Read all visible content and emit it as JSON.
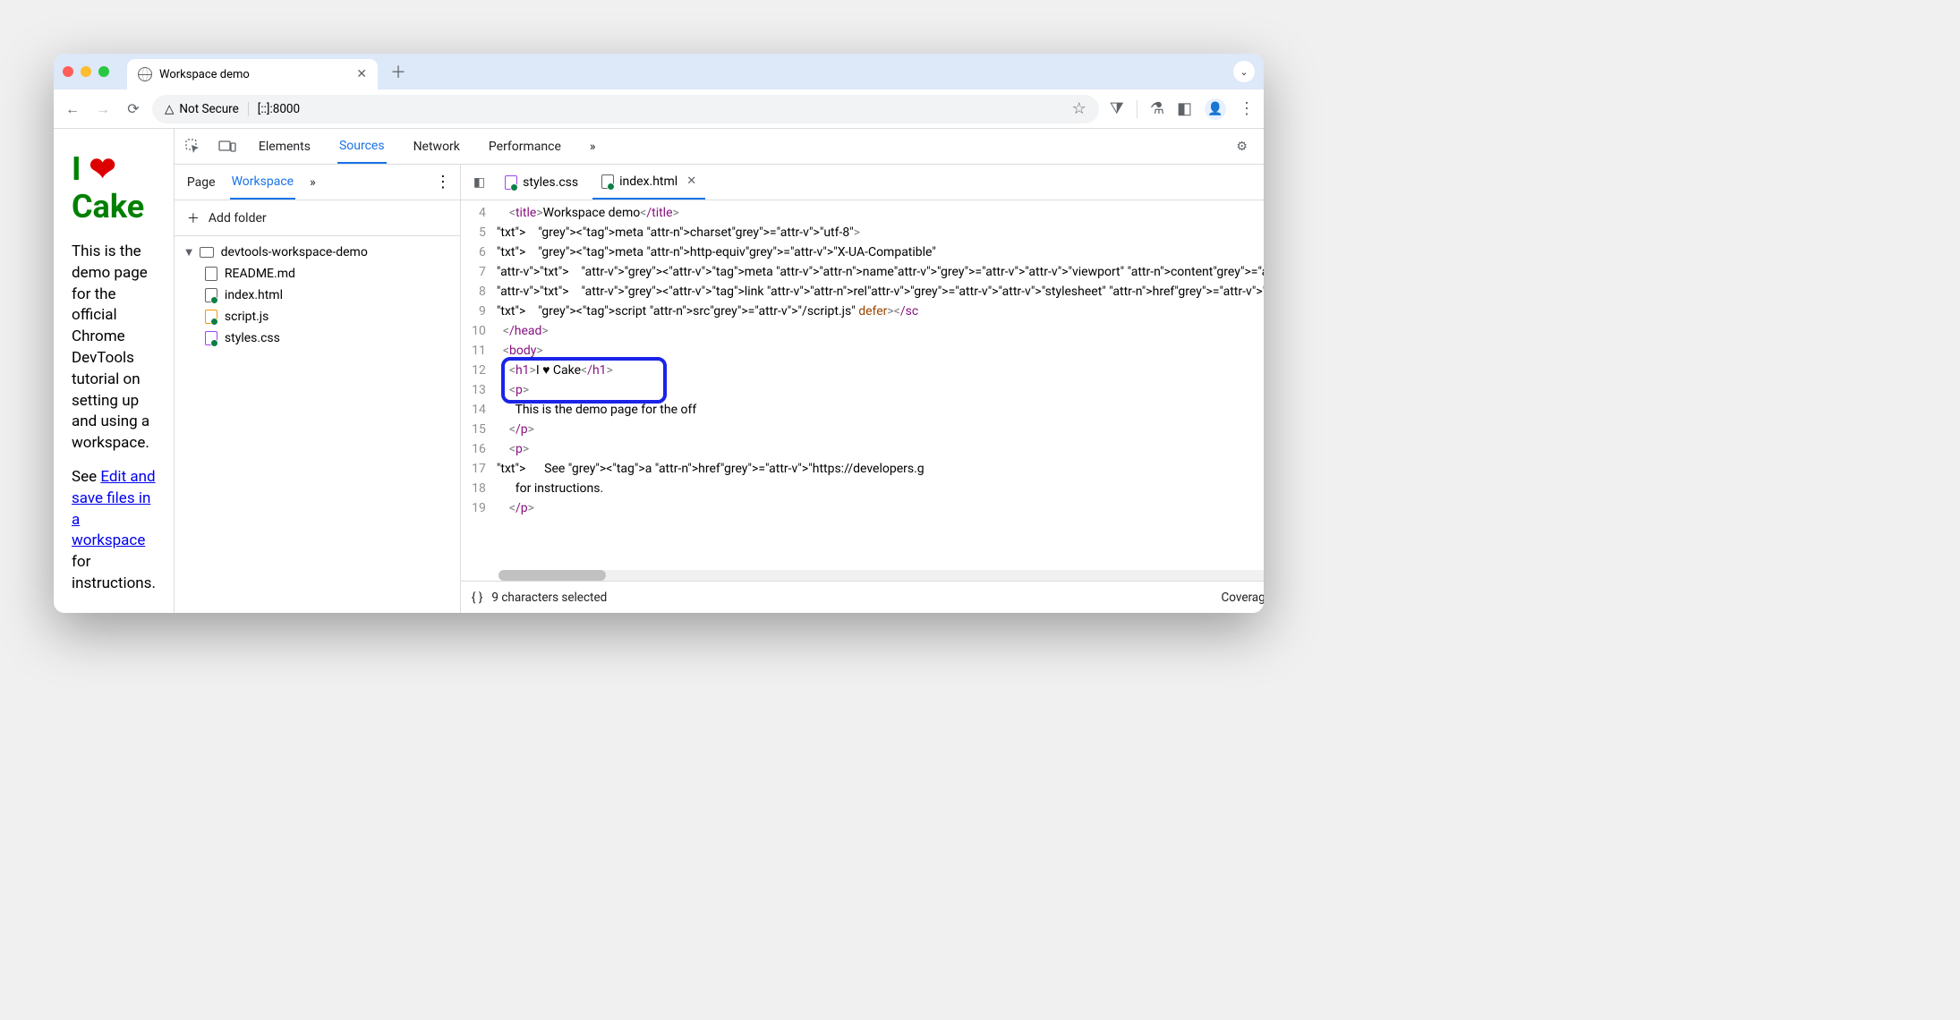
{
  "browser": {
    "tab_title": "Workspace demo",
    "addr_security": "Not Secure",
    "addr_url": "[::]:8000"
  },
  "demo_page": {
    "heading_pre": "I ",
    "heading_heart": "❤",
    "heading_post": " Cake",
    "para1": "This is the demo page for the official Chrome DevTools tutorial on setting up and using a workspace.",
    "para2_pre": "See ",
    "para2_link": "Edit and save files in a workspace",
    "para2_post": " for instructions."
  },
  "devtools": {
    "tabs": {
      "elements": "Elements",
      "sources": "Sources",
      "network": "Network",
      "performance": "Performance",
      "more": "»"
    },
    "sources_nav": {
      "page": "Page",
      "workspace": "Workspace",
      "more": "»",
      "add_folder": "Add folder",
      "folder": "devtools-workspace-demo",
      "files": {
        "readme": "README.md",
        "index": "index.html",
        "script": "script.js",
        "styles": "styles.css"
      }
    },
    "editor": {
      "open_tabs": {
        "styles": "styles.css",
        "index": "index.html"
      },
      "lines": [
        {
          "n": 4,
          "h": "    <title>Workspace demo</title>"
        },
        {
          "n": 5,
          "h": "    <meta charset=\"utf-8\">"
        },
        {
          "n": 6,
          "h": "    <meta http-equiv=\"X-UA-Compatible\" "
        },
        {
          "n": 7,
          "h": "    <meta name=\"viewport\" content=\"widt"
        },
        {
          "n": 8,
          "h": "    <link rel=\"stylesheet\" href=\"/style"
        },
        {
          "n": 9,
          "h": "    <script src=\"/script.js\" defer></sc"
        },
        {
          "n": 10,
          "h": "  </head>"
        },
        {
          "n": 11,
          "h": "  <body>"
        },
        {
          "n": 12,
          "h": "    <h1>I ♥ Cake</h1>"
        },
        {
          "n": 13,
          "h": "    <p>"
        },
        {
          "n": 14,
          "h": "      This is the demo page for the off"
        },
        {
          "n": 15,
          "h": "    </p>"
        },
        {
          "n": 16,
          "h": "    <p>"
        },
        {
          "n": 17,
          "h": "      See <a href=\"https://developers.g"
        },
        {
          "n": 18,
          "h": "      for instructions."
        },
        {
          "n": 19,
          "h": "    </p>"
        }
      ]
    },
    "status": {
      "selection": "9 characters selected",
      "coverage": "Coverage: n/a"
    }
  }
}
